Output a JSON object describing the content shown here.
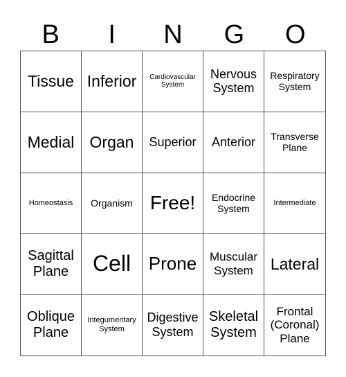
{
  "header": [
    "B",
    "I",
    "N",
    "G",
    "O"
  ],
  "cells": [
    [
      "Tissue",
      "Inferior",
      "Cardiovascular System",
      "Nervous System",
      "Respiratory System"
    ],
    [
      "Medial",
      "Organ",
      "Superior",
      "Anterior",
      "Transverse Plane"
    ],
    [
      "Homeostasis",
      "Organism",
      "Free!",
      "Endocrine System",
      "Intermediate"
    ],
    [
      "Sagittal Plane",
      "Cell",
      "Prone",
      "Muscular System",
      "Lateral"
    ],
    [
      "Oblique Plane",
      "Integumentary System",
      "Digestive System",
      "Skeletal System",
      "Frontal (Coronal) Plane"
    ]
  ]
}
